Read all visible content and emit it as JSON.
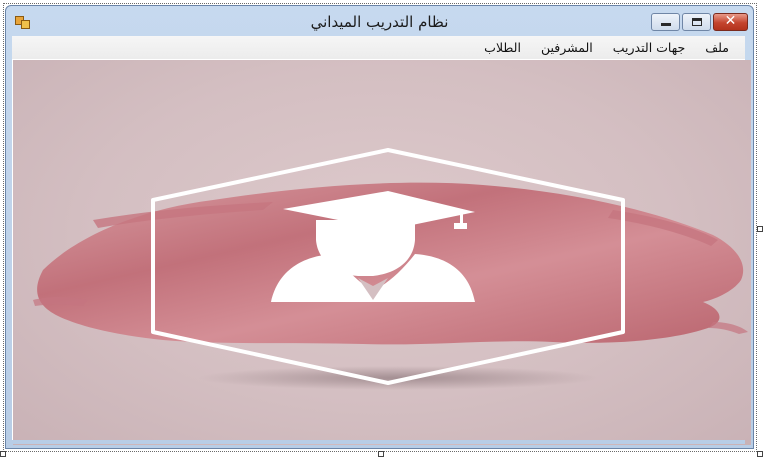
{
  "window": {
    "title": "نظام التدريب الميداني"
  },
  "menu": {
    "items": [
      {
        "label": "ملف"
      },
      {
        "label": "جهات التدريب"
      },
      {
        "label": "المشرفين"
      },
      {
        "label": "الطلاب"
      }
    ]
  },
  "picture": {
    "icon": "graduate-student-icon",
    "brush_color": "#c2727c",
    "frame_color": "#ffffff"
  },
  "colors": {
    "titlebar": "#c6d9ef",
    "close_button": "#c4442e"
  }
}
